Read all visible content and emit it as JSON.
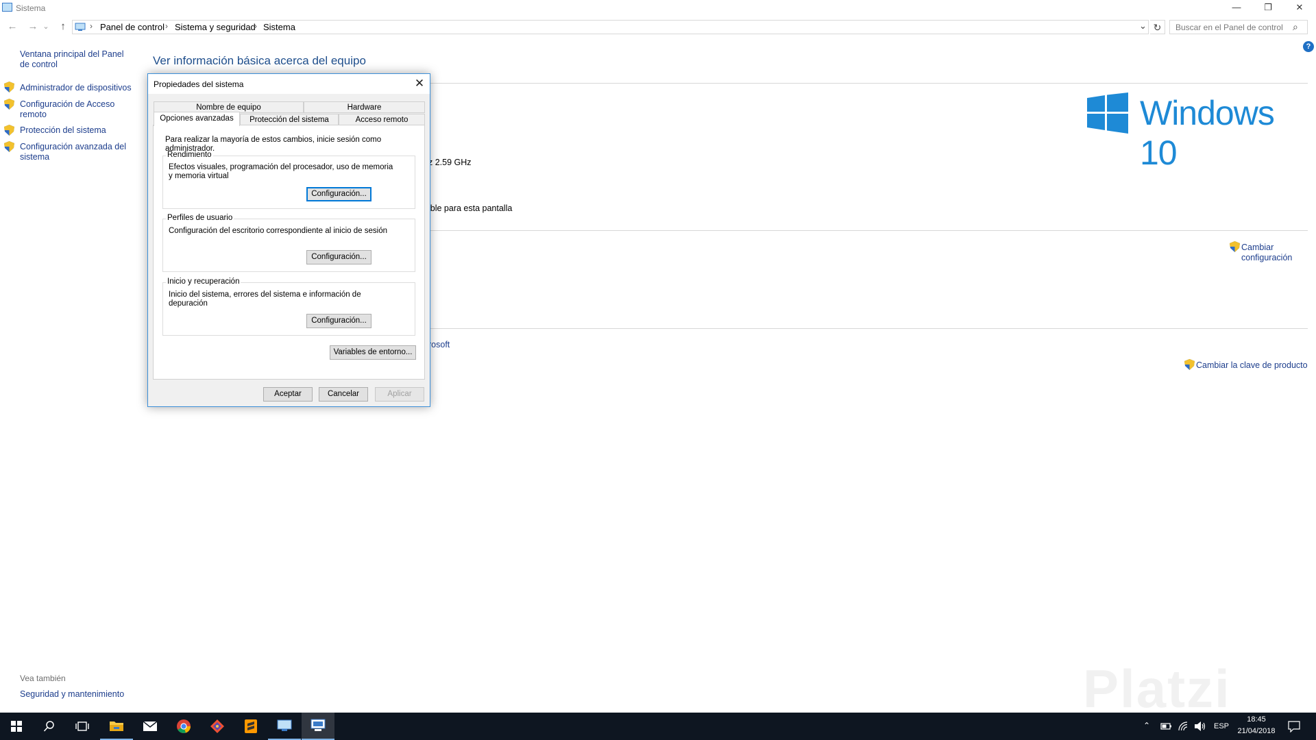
{
  "window": {
    "title": "Sistema",
    "minimize": "—",
    "maximize": "❐",
    "close": "✕"
  },
  "navigation": {
    "back": "←",
    "forward": "→",
    "recent": "⌄",
    "up": "↑",
    "breadcrumb": [
      "Panel de control",
      "Sistema y seguridad",
      "Sistema"
    ],
    "separator": "›",
    "dropdown": "⌄",
    "refresh": "↻",
    "search_placeholder": "Buscar en el Panel de control",
    "search_icon": "⌕"
  },
  "sidebar": {
    "home_link": "Ventana principal del Panel de control",
    "items": [
      {
        "label": "Administrador de dispositivos",
        "icon": "shield-icon"
      },
      {
        "label": "Configuración de Acceso remoto",
        "icon": "shield-icon"
      },
      {
        "label": "Protección del sistema",
        "icon": "shield-icon"
      },
      {
        "label": "Configuración avanzada del sistema",
        "icon": "shield-icon"
      }
    ],
    "see_also": "Vea también",
    "see_also_link": "Seguridad y mantenimiento"
  },
  "main": {
    "heading": "Ver información básica acerca del equipo",
    "help": "?",
    "brand": "Windows 10",
    "processor_fragment": "z  2.59 GHz",
    "display_fragment": "ible para esta pantalla",
    "change_settings": "Cambiar configuración",
    "microsoft_fragment": "rosoft",
    "change_product_key": "Cambiar la clave de producto"
  },
  "dialog": {
    "title": "Propiedades del sistema",
    "close": "✕",
    "tabs_row1": [
      "Nombre de equipo",
      "Hardware"
    ],
    "tabs_row2": [
      "Opciones avanzadas",
      "Protección del sistema",
      "Acceso remoto"
    ],
    "intro": "Para realizar la mayoría de estos cambios, inicie sesión como administrador.",
    "groups": [
      {
        "title": "Rendimiento",
        "text": "Efectos visuales, programación del procesador, uso de memoria y memoria virtual",
        "button": "Configuración..."
      },
      {
        "title": "Perfiles de usuario",
        "text": "Configuración del escritorio correspondiente al inicio de sesión",
        "button": "Configuración..."
      },
      {
        "title": "Inicio y recuperación",
        "text": "Inicio del sistema, errores del sistema e información de depuración",
        "button": "Configuración..."
      }
    ],
    "env_button": "Variables de entorno...",
    "ok": "Aceptar",
    "cancel": "Cancelar",
    "apply": "Aplicar"
  },
  "taskbar": {
    "apps": [
      "start-icon",
      "search-icon",
      "task-view-icon",
      "file-explorer-icon",
      "mail-icon",
      "chrome-icon",
      "git-icon",
      "sublime-icon",
      "control-panel-icon",
      "system-properties-icon"
    ],
    "tray_language": "ESP",
    "time": "18:45",
    "date": "21/04/2018"
  },
  "watermark": "Platzi",
  "colors": {
    "accent": "#0078d7",
    "link": "#1c3d8c",
    "heading": "#1e4e8c",
    "windows_blue": "#1e8ad6",
    "taskbar": "#0e1621"
  }
}
